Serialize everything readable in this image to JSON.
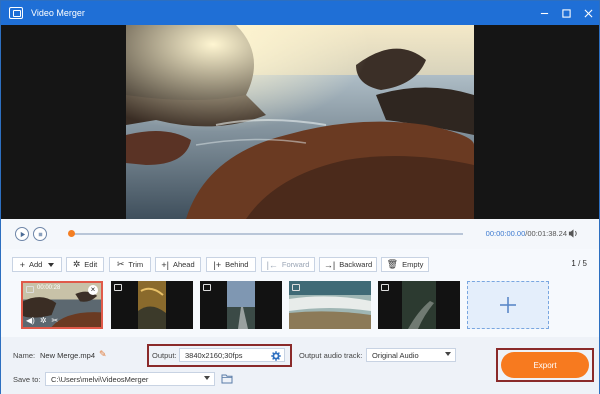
{
  "window": {
    "title": "Video Merger"
  },
  "player": {
    "current_time": "00:00:00.00",
    "duration": "/00:01:38.24",
    "progress": 0.0
  },
  "toolbar": {
    "add": "Add",
    "edit": "Edit",
    "trim": "Trim",
    "ahead": "Ahead",
    "behind": "Behind",
    "forward": "Forward",
    "backward": "Backward",
    "empty": "Empty",
    "page_current": "1",
    "page_total": "/ 5"
  },
  "clips": [
    {
      "time": "00:00:28",
      "selected": true
    },
    {
      "selected": false
    },
    {
      "selected": false
    },
    {
      "selected": false
    },
    {
      "selected": false
    }
  ],
  "bottom": {
    "name_label": "Name:",
    "name_value": "New Merge.mp4",
    "output_label": "Output:",
    "output_value": "3840x2160;30fps",
    "audio_label": "Output audio track:",
    "audio_value": "Original Audio",
    "save_label": "Save to:",
    "save_path": "C:\\Users\\melvi\\VideosMerger",
    "export": "Export"
  },
  "colors": {
    "accent": "#1f6fd6",
    "export": "#f77a1f",
    "highlight": "#8a2a2a"
  }
}
